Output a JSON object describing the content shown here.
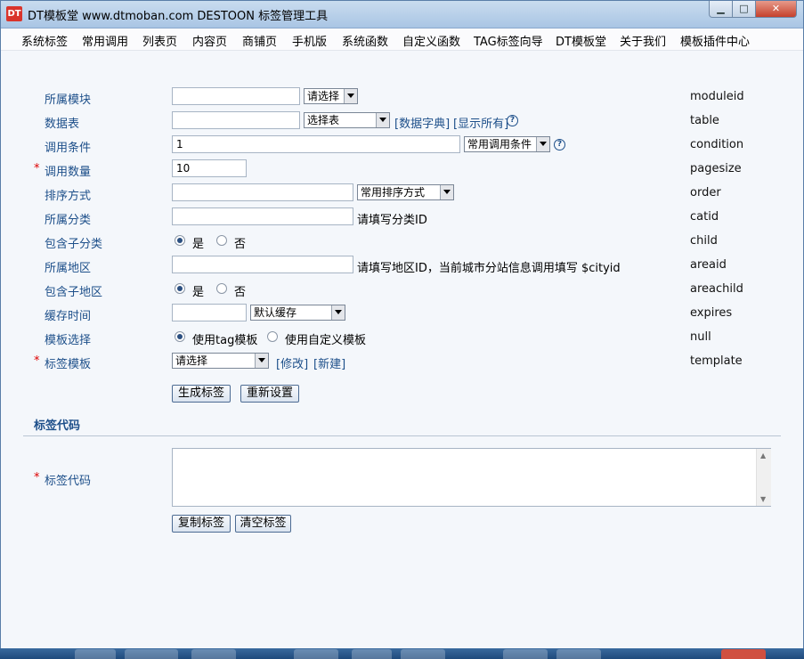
{
  "window": {
    "icon_text": "DT",
    "title": "DT模板堂 www.dtmoban.com DESTOON 标签管理工具",
    "minimize": "▁",
    "maximize": "□",
    "close": "✕"
  },
  "menu": [
    "系统标签",
    "常用调用",
    "列表页",
    "内容页",
    "商铺页",
    "手机版",
    "系统函数",
    "自定义函数",
    "TAG标签向导",
    "DT模板堂",
    "关于我们",
    "模板插件中心"
  ],
  "form": {
    "moduleid": {
      "label": "所属模块",
      "value": "",
      "select": "请选择",
      "var": "moduleid"
    },
    "table": {
      "label": "数据表",
      "value": "",
      "select": "选择表",
      "link_dict": "[数据字典]",
      "link_all": "[显示所有]",
      "help": "?",
      "var": "table"
    },
    "condition": {
      "label": "调用条件",
      "value": "1",
      "select": "常用调用条件",
      "help": "?",
      "var": "condition"
    },
    "pagesize": {
      "required": "*",
      "label": "调用数量",
      "value": "10",
      "var": "pagesize"
    },
    "order": {
      "label": "排序方式",
      "value": "",
      "select": "常用排序方式",
      "var": "order"
    },
    "catid": {
      "label": "所属分类",
      "value": "",
      "hint": "请填写分类ID",
      "var": "catid"
    },
    "child": {
      "label": "包含子分类",
      "yes": "是",
      "no": "否",
      "selected": "是",
      "var": "child"
    },
    "areaid": {
      "label": "所属地区",
      "value": "",
      "hint": "请填写地区ID，当前城市分站信息调用填写 $cityid",
      "var": "areaid"
    },
    "areachild": {
      "label": "包含子地区",
      "yes": "是",
      "no": "否",
      "selected": "是",
      "var": "areachild"
    },
    "expires": {
      "label": "缓存时间",
      "value": "",
      "select": "默认缓存",
      "var": "expires"
    },
    "tpl_choice": {
      "label": "模板选择",
      "opt1": "使用tag模板",
      "opt2": "使用自定义模板",
      "selected": "使用tag模板",
      "var": "null"
    },
    "template": {
      "required": "*",
      "label": "标签模板",
      "select": "请选择",
      "link_edit": "[修改]",
      "link_new": "[新建]",
      "var": "template"
    }
  },
  "buttons": {
    "generate": "生成标签",
    "reset": "重新设置",
    "copy": "复制标签",
    "clear": "清空标签"
  },
  "code_section": {
    "title": "标签代码",
    "required": "*",
    "label": "标签代码",
    "value": ""
  }
}
